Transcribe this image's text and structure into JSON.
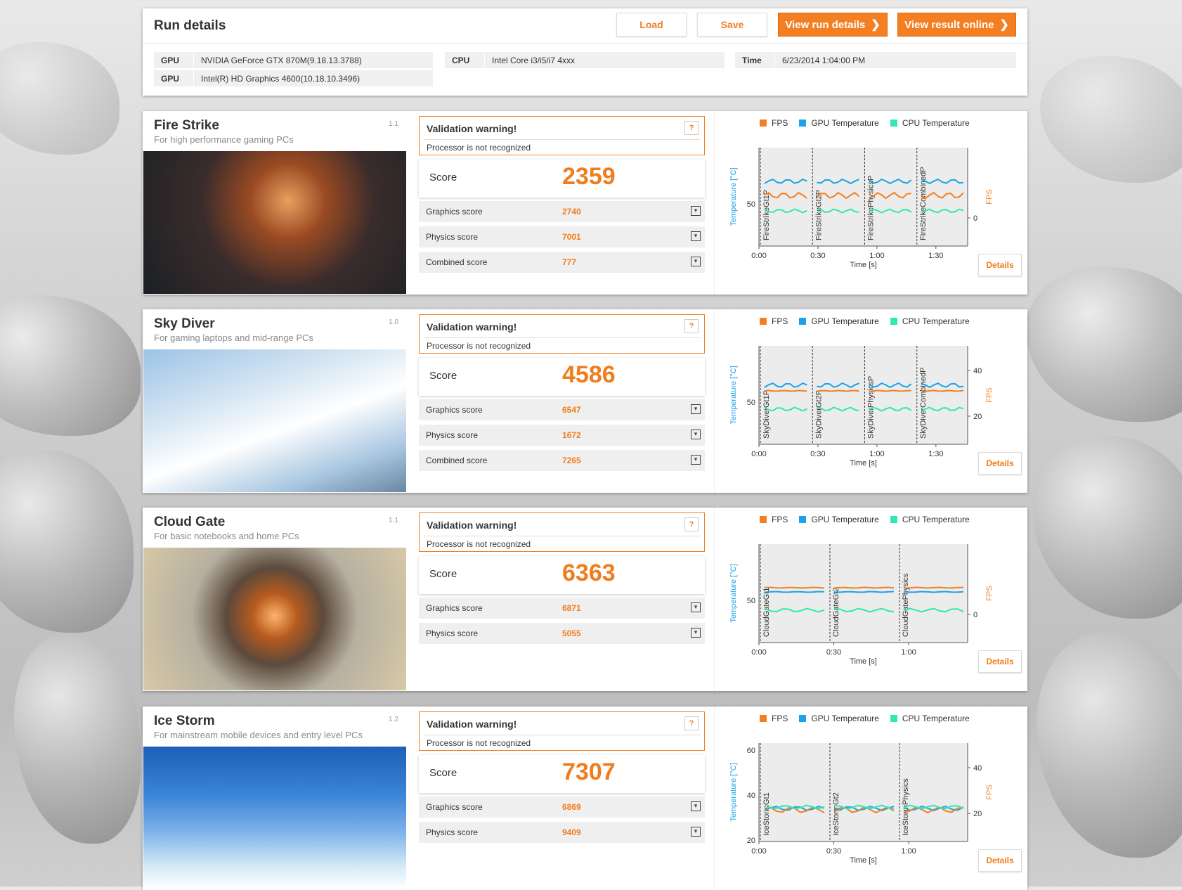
{
  "run_details": {
    "title": "Run details",
    "buttons": {
      "load": "Load",
      "save": "Save",
      "view_run": "View run details",
      "view_online": "View result online"
    },
    "gpu_label": "GPU",
    "gpu1": "NVIDIA GeForce GTX 870M(9.18.13.3788)",
    "gpu2": "Intel(R) HD Graphics 4600(10.18.10.3496)",
    "cpu_label": "CPU",
    "cpu": "Intel Core i3/i5/i7 4xxx",
    "time_label": "Time",
    "time": "6/23/2014 1:04:00 PM"
  },
  "common": {
    "warn_title": "Validation warning!",
    "warn_msg": "Processor is not recognized",
    "warn_help": "?",
    "score_label": "Score",
    "legend_fps": "FPS",
    "legend_gpu": "GPU Temperature",
    "legend_cpu": "CPU Temperature",
    "y_left": "Temperature [°C]",
    "y_right": "FPS",
    "x_label": "Time [s]",
    "details": "Details",
    "dropdown": "▾"
  },
  "colors": {
    "fps": "#f47f22",
    "gpu": "#1aa3e8",
    "cpu": "#2ee8b5",
    "accent": "#f07d1c"
  },
  "tests": [
    {
      "title": "Fire Strike",
      "subtitle": "For high performance gaming PCs",
      "version": "1.1",
      "score": "2359",
      "subscores": [
        {
          "label": "Graphics score",
          "value": "2740"
        },
        {
          "label": "Physics score",
          "value": "7001"
        },
        {
          "label": "Combined score",
          "value": "777"
        }
      ],
      "chart": {
        "segments": [
          "FireStrikeGt1P",
          "FireStrikeGt2P",
          "FireStrikePhysicsP",
          "FireStrikeCombinedP"
        ],
        "xticks": [
          "0:00",
          "0:30",
          "1:00",
          "1:30"
        ],
        "left_ticks": [
          "50"
        ],
        "right_ticks": [
          "0"
        ]
      }
    },
    {
      "title": "Sky Diver",
      "subtitle": "For gaming laptops and mid-range PCs",
      "version": "1.0",
      "score": "4586",
      "subscores": [
        {
          "label": "Graphics score",
          "value": "6547"
        },
        {
          "label": "Physics score",
          "value": "1672"
        },
        {
          "label": "Combined score",
          "value": "7265"
        }
      ],
      "chart": {
        "segments": [
          "SkyDiverGt1P",
          "SkyDiverGt2P",
          "SkyDiverPhysicsP",
          "SkyDiverCombinedP"
        ],
        "xticks": [
          "0:00",
          "0:30",
          "1:00",
          "1:30"
        ],
        "left_ticks": [
          "50"
        ],
        "right_ticks": [
          "40",
          "20"
        ]
      }
    },
    {
      "title": "Cloud Gate",
      "subtitle": "For basic notebooks and home PCs",
      "version": "1.1",
      "score": "6363",
      "subscores": [
        {
          "label": "Graphics score",
          "value": "6871"
        },
        {
          "label": "Physics score",
          "value": "5055"
        }
      ],
      "chart": {
        "segments": [
          "CloudGateGt1",
          "CloudGateGt2",
          "CloudGatePhysics"
        ],
        "xticks": [
          "0:00",
          "0:30",
          "1:00"
        ],
        "left_ticks": [
          "50"
        ],
        "right_ticks": [
          "0"
        ]
      }
    },
    {
      "title": "Ice Storm",
      "subtitle": "For mainstream mobile devices and entry level PCs",
      "version": "1.2",
      "score": "7307",
      "subscores": [
        {
          "label": "Graphics score",
          "value": "6869"
        },
        {
          "label": "Physics score",
          "value": "9409"
        }
      ],
      "chart": {
        "segments": [
          "IceStormGt1",
          "IceStormGt2",
          "IceStormPhysics"
        ],
        "xticks": [
          "0:00",
          "0:30",
          "1:00"
        ],
        "left_ticks": [
          "60",
          "40",
          "20"
        ],
        "right_ticks": [
          "40",
          "20"
        ]
      }
    }
  ]
}
